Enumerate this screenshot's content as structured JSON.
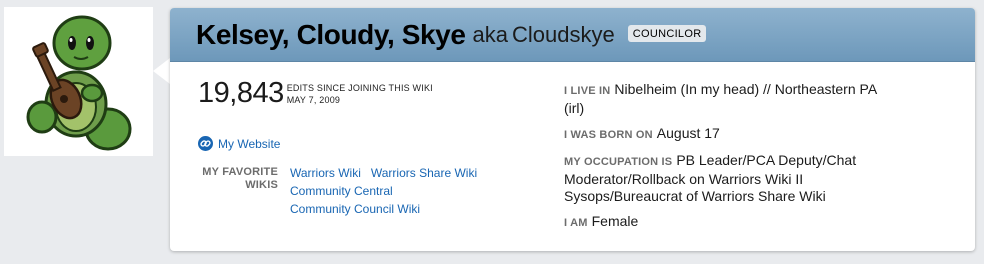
{
  "profile": {
    "real_name": "Kelsey, Cloudy, Skye",
    "aka_label": "aka",
    "username": "Cloudskye",
    "group": "COUNCILOR"
  },
  "stats": {
    "edit_count": "19,843",
    "edits_label": "EDITS SINCE JOINING THIS WIKI",
    "join_date": "MAY 7, 2009"
  },
  "website": {
    "label": "My Website"
  },
  "favorite_wikis": {
    "label": "MY FAVORITE WIKIS",
    "items": [
      "Warriors Wiki",
      "Warriors Share Wiki",
      "Community Central",
      "Community Council Wiki"
    ]
  },
  "details": {
    "live_label": "I LIVE IN",
    "live_value": "Nibelheim (In my head) // Northeastern PA (irl)",
    "born_label": "I WAS BORN ON",
    "born_value": "August 17",
    "occupation_label": "MY OCCUPATION IS",
    "occupation_value": "PB Leader/PCA Deputy/Chat Moderator/Rollback on Warriors Wiki II Sysops/Bureaucrat of Warriors Share Wiki",
    "gender_label": "I AM",
    "gender_value": "Female"
  },
  "colors": {
    "header_gradient_top": "#8eb2ce",
    "header_gradient_bottom": "#6d98ba",
    "link": "#1966b3",
    "label_gray": "#6c6c6c",
    "avatar_turtle": "#4c9a3a"
  },
  "icons": {
    "avatar": "turtle-with-guitar",
    "website": "link-chain-icon"
  }
}
